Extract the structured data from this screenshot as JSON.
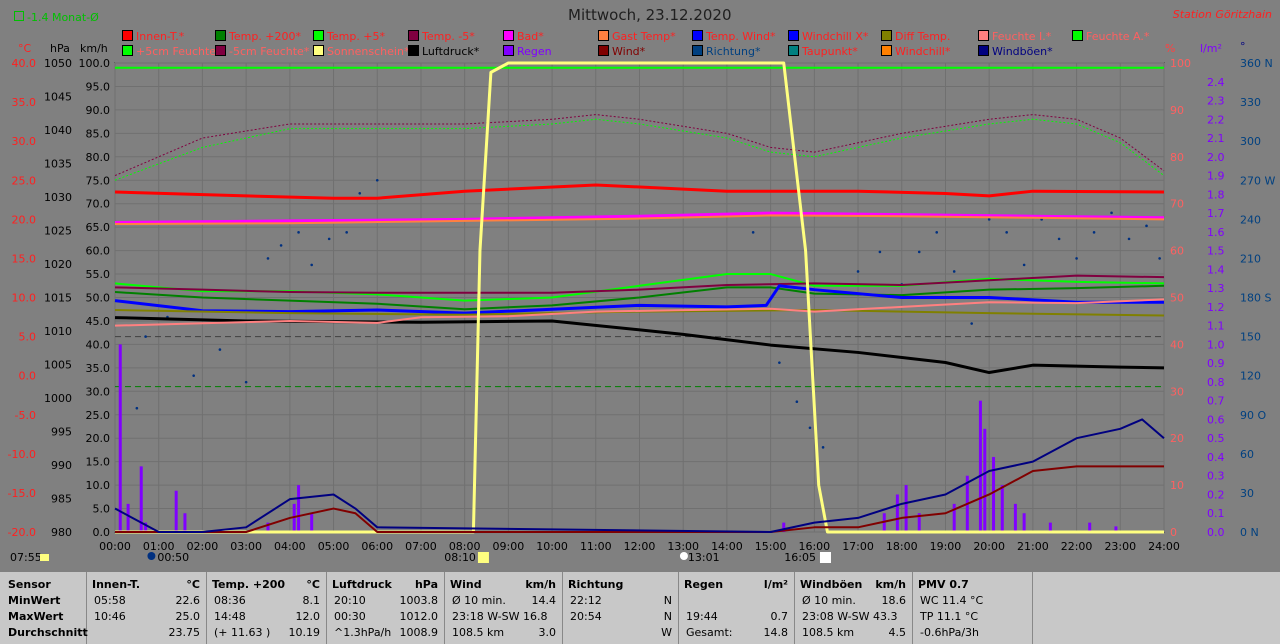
{
  "header": {
    "month_delta": "-1.4 Monat-Ø",
    "title": "Mittwoch, 23.12.2020",
    "station": "Station Göritzhain",
    "unit_c": "°C",
    "unit_hpa": "hPa",
    "unit_kmh": "km/h",
    "unit_pct": "%",
    "unit_lm2": "l/m²",
    "unit_deg": "°"
  },
  "legend": [
    {
      "label": "Innen-T.*",
      "color": "#ff0000",
      "tcolor": "#ff2020"
    },
    {
      "label": "Temp. +200*",
      "color": "#008000",
      "tcolor": "#ff2020"
    },
    {
      "label": "Temp. +5*",
      "color": "#00ff00",
      "tcolor": "#ff2020"
    },
    {
      "label": "Temp. -5*",
      "color": "#800040",
      "tcolor": "#ff2020"
    },
    {
      "label": "Bad*",
      "color": "#ff00ff",
      "tcolor": "#ff2020"
    },
    {
      "label": "Gast Temp*",
      "color": "#ff8040",
      "tcolor": "#ff2020"
    },
    {
      "label": "Temp. Wind*",
      "color": "#0000ff",
      "tcolor": "#ff2020"
    },
    {
      "label": "Windchill X*",
      "color": "#0000ff",
      "tcolor": "#ff2020"
    },
    {
      "label": "Diff Temp.",
      "color": "#808000",
      "tcolor": "#ff2020"
    },
    {
      "label": "Feuchte I.*",
      "color": "#ff8080",
      "tcolor": "#ff6060"
    },
    {
      "label": "Feuchte A.*",
      "color": "#00ff00",
      "tcolor": "#ff6060"
    },
    {
      "label": "+5cm Feuchte*",
      "color": "#00ff00",
      "tcolor": "#ff6060"
    },
    {
      "label": "-5cm Feuchte*",
      "color": "#800040",
      "tcolor": "#ff6060"
    },
    {
      "label": "Sonnenschein*",
      "color": "#ffff80",
      "tcolor": "#ff6060"
    },
    {
      "label": "Luftdruck*",
      "color": "#000000",
      "tcolor": "#000000"
    },
    {
      "label": "Regen",
      "color": "#8000ff",
      "tcolor": "#8000ff"
    },
    {
      "label": "Wind*",
      "color": "#800000",
      "tcolor": "#800000"
    },
    {
      "label": "Richtung*",
      "color": "#004080",
      "tcolor": "#004080"
    },
    {
      "label": "Taupunkt*",
      "color": "#008080",
      "tcolor": "#ff2020"
    },
    {
      "label": "Windchill*",
      "color": "#ff8000",
      "tcolor": "#ff2020"
    },
    {
      "label": "Windböen*",
      "color": "#000080",
      "tcolor": "#000080"
    }
  ],
  "chart_data": {
    "type": "line",
    "x_ticks": [
      "00:00",
      "01:00",
      "02:00",
      "03:00",
      "04:00",
      "05:00",
      "06:00",
      "07:00",
      "08:00",
      "09:00",
      "10:00",
      "11:00",
      "12:00",
      "13:00",
      "14:00",
      "15:00",
      "16:00",
      "17:00",
      "18:00",
      "19:00",
      "20:00",
      "21:00",
      "22:00",
      "23:00",
      "24:00"
    ],
    "axes": {
      "temp_c": {
        "ticks": [
          "40.0",
          "35.0",
          "30.0",
          "25.0",
          "20.0",
          "15.0",
          "10.0",
          "5.0",
          "0.0",
          "-5.0",
          "-10.0",
          "-15.0",
          "-20.0"
        ],
        "ylim": [
          -20,
          40
        ]
      },
      "pressure_hpa": {
        "ticks": [
          "1050",
          "1045",
          "1040",
          "1035",
          "1030",
          "1025",
          "1020",
          "1015",
          "1010",
          "1005",
          "1000",
          "995",
          "990",
          "985",
          "980"
        ],
        "ylim": [
          980,
          1050
        ]
      },
      "wind_kmh": {
        "ticks": [
          "100.0",
          "95.0",
          "90.0",
          "85.0",
          "80.0",
          "75.0",
          "70.0",
          "65.0",
          "60.0",
          "55.0",
          "50.0",
          "45.0",
          "40.0",
          "35.0",
          "30.0",
          "25.0",
          "20.0",
          "15.0",
          "10.0",
          "5.0",
          "0.0"
        ],
        "ylim": [
          0,
          100
        ]
      },
      "humidity_pct": {
        "ticks": [
          "100",
          "90",
          "80",
          "70",
          "60",
          "50",
          "40",
          "30",
          "20",
          "10",
          "0"
        ],
        "ylim": [
          0,
          100
        ]
      },
      "rain_lm2": {
        "ticks": [
          "2.4",
          "2.3",
          "2.2",
          "2.1",
          "2.0",
          "1.9",
          "1.8",
          "1.7",
          "1.6",
          "1.5",
          "1.4",
          "1.3",
          "1.2",
          "1.1",
          "1.0",
          "0.9",
          "0.8",
          "0.7",
          "0.6",
          "0.5",
          "0.4",
          "0.3",
          "0.2",
          "0.1",
          "0.0"
        ],
        "ylim": [
          0,
          2.5
        ]
      },
      "direction": {
        "ticks": [
          "360 N",
          "330",
          "300",
          "270 W",
          "240",
          "210",
          "180 S",
          "150",
          "120",
          "90 O",
          "60",
          "30",
          "0 N"
        ],
        "ylim": [
          0,
          360
        ]
      }
    },
    "markers": {
      "sunrise": "08:10",
      "sunset": "16:05",
      "moon1": "00:50",
      "moon2": "13:01",
      "left": "07:55"
    },
    "series": [
      {
        "name": "Innen-T.*",
        "axis": "temp_c",
        "color": "#ff0000",
        "width": 3,
        "x": [
          0,
          3,
          5,
          6,
          8,
          11,
          14,
          17,
          19,
          20,
          21,
          24
        ],
        "y": [
          23.5,
          23.0,
          22.7,
          22.7,
          23.6,
          24.4,
          23.6,
          23.6,
          23.3,
          23.0,
          23.6,
          23.5
        ]
      },
      {
        "name": "Bad*",
        "axis": "temp_c",
        "color": "#ff00ff",
        "width": 3,
        "x": [
          0,
          4,
          8,
          12,
          15,
          18,
          21,
          24
        ],
        "y": [
          19.6,
          19.8,
          20.0,
          20.4,
          20.8,
          20.6,
          20.4,
          20.2
        ]
      },
      {
        "name": "Gast Temp*",
        "axis": "temp_c",
        "color": "#ff8040",
        "width": 2,
        "x": [
          0,
          4,
          8,
          12,
          15,
          18,
          21,
          24
        ],
        "y": [
          19.4,
          19.5,
          19.8,
          20.1,
          20.5,
          20.4,
          20.2,
          20.0
        ]
      },
      {
        "name": "Luftdruck*",
        "axis": "pressure_hpa",
        "color": "#000000",
        "width": 3,
        "x": [
          0,
          3,
          7,
          10,
          13,
          15,
          17,
          19,
          20,
          21,
          23,
          24
        ],
        "y": [
          1012.0,
          1011.5,
          1011.3,
          1011.5,
          1009.5,
          1007.9,
          1006.8,
          1005.3,
          1003.8,
          1004.9,
          1004.6,
          1004.5
        ]
      },
      {
        "name": "Temp. +200*",
        "axis": "temp_c",
        "color": "#008000",
        "width": 2,
        "x": [
          0,
          2,
          4,
          6,
          8,
          10,
          12,
          14,
          15,
          16,
          18,
          20,
          22,
          24
        ],
        "y": [
          10.7,
          10.0,
          9.6,
          9.2,
          8.5,
          9.0,
          10.0,
          11.3,
          11.3,
          10.5,
          10.3,
          11.0,
          11.2,
          11.5
        ]
      },
      {
        "name": "Temp. +5*",
        "axis": "temp_c",
        "color": "#00ff00",
        "width": 2,
        "x": [
          0,
          2,
          4,
          6,
          8,
          10,
          12,
          14,
          15,
          16,
          18,
          20,
          22,
          24
        ],
        "y": [
          11.8,
          10.8,
          10.8,
          10.4,
          9.6,
          10.0,
          11.5,
          13.0,
          13.0,
          11.5,
          11.5,
          12.4,
          12.0,
          11.8
        ]
      },
      {
        "name": "Temp. -5*",
        "axis": "temp_c",
        "color": "#800040",
        "width": 2,
        "x": [
          0,
          2,
          4,
          6,
          8,
          10,
          12,
          14,
          16,
          18,
          20,
          22,
          24
        ],
        "y": [
          11.3,
          11.0,
          10.7,
          10.6,
          10.6,
          10.6,
          11.0,
          11.6,
          11.8,
          11.6,
          12.2,
          12.8,
          12.6
        ]
      },
      {
        "name": "Temp. Wind*",
        "axis": "temp_c",
        "color": "#0000ff",
        "width": 3,
        "x": [
          0,
          2,
          4,
          6,
          8,
          10,
          12,
          14,
          14.9,
          15.2,
          16,
          18,
          20,
          22,
          24
        ],
        "y": [
          9.6,
          8.3,
          8.2,
          8.4,
          8.0,
          8.5,
          9.0,
          8.8,
          9.0,
          11.5,
          11.0,
          10.0,
          10.0,
          9.4,
          9.4
        ]
      },
      {
        "name": "Diff Temp.",
        "axis": "temp_c",
        "color": "#808000",
        "width": 2,
        "x": [
          0,
          4,
          8,
          12,
          16,
          20,
          24
        ],
        "y": [
          8.4,
          8.0,
          7.8,
          8.2,
          8.4,
          8.0,
          7.7
        ]
      },
      {
        "name": "Feuchte I.*",
        "axis": "humidity_pct",
        "color": "#ff8080",
        "width": 2,
        "x": [
          0,
          2,
          4,
          6,
          7,
          9,
          11,
          13,
          15,
          16,
          18,
          20,
          22,
          24
        ],
        "y": [
          44.0,
          44.5,
          45.0,
          44.6,
          45.8,
          46.0,
          47.0,
          47.3,
          47.6,
          47.0,
          48.0,
          49.0,
          48.8,
          49.6
        ]
      },
      {
        "name": "Feuchte A.*",
        "axis": "humidity_pct",
        "color": "#00ff00",
        "width": 2,
        "x": [
          0,
          24
        ],
        "y": [
          99.0,
          99.0
        ]
      },
      {
        "name": "+5cm Feuchte*",
        "axis": "humidity_pct",
        "color": "#00ff00",
        "width": 1,
        "dash": "2,2",
        "x": [
          0,
          2,
          4,
          6,
          8,
          10,
          11,
          12,
          14,
          15,
          16,
          17,
          18,
          20,
          21,
          22,
          23,
          24
        ],
        "y": [
          75,
          82,
          86,
          86,
          86,
          87,
          88,
          87,
          84,
          81,
          80,
          82,
          84,
          87,
          88,
          87,
          83,
          76
        ]
      },
      {
        "name": "-5cm Feuchte*",
        "axis": "humidity_pct",
        "color": "#800040",
        "width": 1,
        "dash": "2,2",
        "x": [
          0,
          2,
          4,
          6,
          8,
          10,
          11,
          12,
          14,
          15,
          16,
          17,
          18,
          20,
          21,
          22,
          23,
          24
        ],
        "y": [
          76,
          84,
          87,
          87,
          87,
          88,
          89,
          88,
          85,
          82,
          81,
          83,
          85,
          88,
          89,
          88,
          84,
          77
        ]
      },
      {
        "name": "Sonnenschein*",
        "axis": "humidity_pct",
        "color": "#ffff80",
        "width": 3,
        "x": [
          0,
          8.2,
          8.35,
          8.6,
          9.0,
          15.3,
          15.8,
          16.1,
          16.3,
          24
        ],
        "y": [
          0,
          0,
          60,
          98,
          100,
          100,
          60,
          10,
          0,
          0
        ]
      },
      {
        "name": "Wind*",
        "axis": "wind_kmh",
        "color": "#800000",
        "width": 2,
        "x": [
          0,
          1,
          2,
          3,
          4,
          5,
          5.5,
          6,
          15,
          16,
          17,
          18,
          19,
          20,
          21,
          22,
          23,
          24
        ],
        "y": [
          0,
          0,
          0,
          0,
          3,
          5,
          4,
          0,
          0,
          1,
          1,
          3,
          4,
          8,
          13,
          14,
          14,
          14
        ]
      },
      {
        "name": "Windböen*",
        "axis": "wind_kmh",
        "color": "#000080",
        "width": 2,
        "x": [
          0,
          1,
          2,
          3,
          4,
          5,
          5.5,
          6,
          15,
          16,
          17,
          18,
          19,
          20,
          21,
          22,
          23,
          23.5,
          24
        ],
        "y": [
          5,
          0,
          0,
          1,
          7,
          8,
          5,
          1,
          0,
          2,
          3,
          6,
          8,
          13,
          15,
          20,
          22,
          24,
          20
        ]
      }
    ],
    "rain_bars": [
      {
        "x": 0.12,
        "v": 1.0
      },
      {
        "x": 0.3,
        "v": 0.15
      },
      {
        "x": 0.6,
        "v": 0.35
      },
      {
        "x": 0.7,
        "v": 0.05
      },
      {
        "x": 1.4,
        "v": 0.22
      },
      {
        "x": 1.6,
        "v": 0.1
      },
      {
        "x": 3.5,
        "v": 0.05
      },
      {
        "x": 4.1,
        "v": 0.15
      },
      {
        "x": 4.2,
        "v": 0.25
      },
      {
        "x": 4.5,
        "v": 0.1
      },
      {
        "x": 15.3,
        "v": 0.05
      },
      {
        "x": 17.6,
        "v": 0.1
      },
      {
        "x": 17.9,
        "v": 0.2
      },
      {
        "x": 18.1,
        "v": 0.25
      },
      {
        "x": 18.4,
        "v": 0.1
      },
      {
        "x": 19.2,
        "v": 0.15
      },
      {
        "x": 19.5,
        "v": 0.3
      },
      {
        "x": 19.8,
        "v": 0.7
      },
      {
        "x": 19.9,
        "v": 0.55
      },
      {
        "x": 20.1,
        "v": 0.4
      },
      {
        "x": 20.3,
        "v": 0.25
      },
      {
        "x": 20.6,
        "v": 0.15
      },
      {
        "x": 20.8,
        "v": 0.1
      },
      {
        "x": 21.4,
        "v": 0.05
      },
      {
        "x": 22.3,
        "v": 0.05
      },
      {
        "x": 22.9,
        "v": 0.03
      }
    ],
    "direction_points": [
      {
        "x": 0.5,
        "y": 95
      },
      {
        "x": 0.7,
        "y": 150
      },
      {
        "x": 1.2,
        "y": 165
      },
      {
        "x": 1.8,
        "y": 120
      },
      {
        "x": 2.4,
        "y": 140
      },
      {
        "x": 3.0,
        "y": 115
      },
      {
        "x": 3.5,
        "y": 210
      },
      {
        "x": 3.8,
        "y": 220
      },
      {
        "x": 4.2,
        "y": 230
      },
      {
        "x": 4.5,
        "y": 205
      },
      {
        "x": 4.9,
        "y": 225
      },
      {
        "x": 5.3,
        "y": 230
      },
      {
        "x": 5.6,
        "y": 260
      },
      {
        "x": 6.0,
        "y": 270
      },
      {
        "x": 14.6,
        "y": 230
      },
      {
        "x": 15.2,
        "y": 130
      },
      {
        "x": 15.6,
        "y": 100
      },
      {
        "x": 15.9,
        "y": 80
      },
      {
        "x": 16.2,
        "y": 65
      },
      {
        "x": 17.0,
        "y": 200
      },
      {
        "x": 17.5,
        "y": 215
      },
      {
        "x": 18.0,
        "y": 190
      },
      {
        "x": 18.4,
        "y": 215
      },
      {
        "x": 18.8,
        "y": 230
      },
      {
        "x": 19.2,
        "y": 200
      },
      {
        "x": 19.6,
        "y": 160
      },
      {
        "x": 20.0,
        "y": 240
      },
      {
        "x": 20.4,
        "y": 230
      },
      {
        "x": 20.8,
        "y": 205
      },
      {
        "x": 21.2,
        "y": 240
      },
      {
        "x": 21.6,
        "y": 225
      },
      {
        "x": 22.0,
        "y": 210
      },
      {
        "x": 22.4,
        "y": 230
      },
      {
        "x": 22.8,
        "y": 245
      },
      {
        "x": 23.2,
        "y": 225
      },
      {
        "x": 23.6,
        "y": 235
      },
      {
        "x": 23.9,
        "y": 210
      }
    ],
    "ref_lines": [
      {
        "axis": "temp_c",
        "y": 5.0,
        "color": "#404040",
        "dash": "6,4"
      },
      {
        "axis": "temp_c",
        "y": -1.4,
        "color": "#008000",
        "dash": "6,4"
      }
    ]
  },
  "table": {
    "rows": [
      "Sensor",
      "MinWert",
      "MaxWert",
      "Durchschnitt"
    ],
    "cols": [
      {
        "name": "Innen-T.",
        "unit": "°C",
        "cells": [
          [
            "05:58",
            "22.6"
          ],
          [
            "10:46",
            "25.0"
          ],
          [
            "",
            "23.75"
          ]
        ]
      },
      {
        "name": "Temp. +200",
        "unit": "°C",
        "cells": [
          [
            "08:36",
            "8.1"
          ],
          [
            "14:48",
            "12.0"
          ],
          [
            "(+ 11.63 )",
            "10.19"
          ]
        ]
      },
      {
        "name": "Luftdruck",
        "unit": "hPa",
        "cells": [
          [
            "20:10",
            "1003.8"
          ],
          [
            "00:30",
            "1012.0"
          ],
          [
            "^1.3hPa/h",
            "1008.9"
          ]
        ]
      },
      {
        "name": "Wind",
        "unit": "km/h",
        "cells": [
          [
            "Ø 10 min.",
            "14.4"
          ],
          [
            "23:18   W-SW 16.8",
            ""
          ],
          [
            "108.5 km",
            "3.0"
          ]
        ]
      },
      {
        "name": "Richtung",
        "unit": "",
        "cells": [
          [
            "22:12",
            "N"
          ],
          [
            "20:54",
            "N"
          ],
          [
            "",
            "W"
          ]
        ]
      },
      {
        "name": "Regen",
        "unit": "l/m²",
        "cells": [
          [
            "",
            ""
          ],
          [
            "19:44",
            "0.7"
          ],
          [
            "Gesamt:",
            "14.8"
          ]
        ]
      },
      {
        "name": "Windböen",
        "unit": "km/h",
        "cells": [
          [
            "Ø 10 min.",
            "18.6"
          ],
          [
            "23:08   W-SW 43.3",
            ""
          ],
          [
            "108.5 km",
            "4.5"
          ]
        ]
      },
      {
        "name": "PMV 0.7",
        "unit": "",
        "cells": [
          [
            "WC 11.4 °C",
            ""
          ],
          [
            "TP 11.1 °C",
            ""
          ],
          [
            "-0.6hPa/3h",
            ""
          ]
        ]
      }
    ]
  }
}
